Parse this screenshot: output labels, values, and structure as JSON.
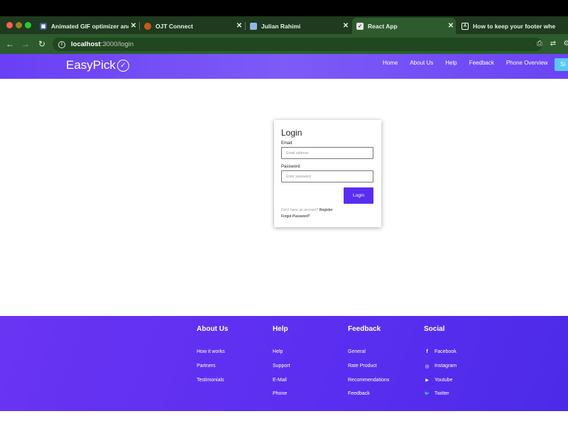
{
  "browser": {
    "tabs": [
      {
        "title": "Animated GIF optimizer and c",
        "icon": "gif-app-icon",
        "active": false
      },
      {
        "title": "OJT Connect",
        "icon": "ojt-icon",
        "active": false
      },
      {
        "title": "Julian Rahimi",
        "icon": "portfolio-icon",
        "active": false
      },
      {
        "title": "React App",
        "icon": "react-app-icon",
        "active": true
      },
      {
        "title": "How to keep your footer whe",
        "icon": "article-icon",
        "active": false
      }
    ],
    "address": {
      "host": "localhost",
      "path": ":3000/login"
    }
  },
  "site": {
    "brand": "EasyPick",
    "nav": [
      "Home",
      "About Us",
      "Help",
      "Feedback",
      "Phone Overview"
    ],
    "signup_label": "Si"
  },
  "login": {
    "title": "Login",
    "email_label": "Email:",
    "email_placeholder": "Email address",
    "password_label": "Password:",
    "password_placeholder": "Enter password",
    "button": "Login",
    "no_account": "Don't have an account?",
    "register": "Register",
    "forgot": "Forgot Password?"
  },
  "footer": {
    "columns": [
      {
        "title": "About Us",
        "links": [
          "How it works",
          "Partners",
          "Testimonials"
        ]
      },
      {
        "title": "Help",
        "links": [
          "Help",
          "Support",
          "E-Mail",
          "Phone"
        ]
      },
      {
        "title": "Feedback",
        "links": [
          "General",
          "Rate Product",
          "Recommendations",
          "Feedback"
        ]
      },
      {
        "title": "Social",
        "links": [
          "Facebook",
          "Instagram",
          "Youtube",
          "Twitter"
        ],
        "icons": [
          "f",
          "◎",
          "▶",
          "🐦"
        ]
      }
    ]
  },
  "colors": {
    "primary": "#5a2ef0",
    "accent": "#58c8f5",
    "chrome": "#2e5b2e"
  }
}
